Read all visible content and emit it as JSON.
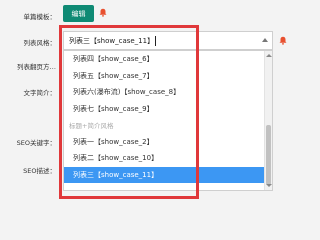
{
  "form": {
    "single_template_label": "单篇模板：",
    "list_style_label": "列表风格：",
    "list_paging_label": "列表翻页方…",
    "text_intro_label": "文字简介：",
    "seo_keywords_label": "SEO关键字：",
    "seo_desc_label": "SEO描述："
  },
  "edit_button": "编辑",
  "select": {
    "value": "列表三【show_case_11】"
  },
  "options": [
    {
      "label": "列表四【show_case_6】",
      "type": "option"
    },
    {
      "label": "列表五【show_case_7】",
      "type": "option"
    },
    {
      "label": "列表六(瀑布流)【show_case_8】",
      "type": "option"
    },
    {
      "label": "列表七【show_case_9】",
      "type": "option"
    },
    {
      "label": "标题+简介风格",
      "type": "group"
    },
    {
      "label": "列表一【show_case_2】",
      "type": "option"
    },
    {
      "label": "列表二【show_case_10】",
      "type": "option"
    },
    {
      "label": "列表三【show_case_11】",
      "type": "selected"
    }
  ],
  "colors": {
    "accent_green": "#0f8a74",
    "highlight_red": "#e0383a",
    "selected_blue": "#3c97f3",
    "bell_orange": "#e8502f"
  }
}
